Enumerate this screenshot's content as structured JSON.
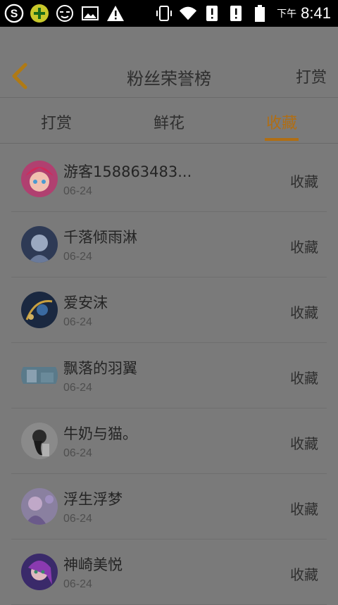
{
  "status_bar": {
    "time_prefix": "下午",
    "time": "8:41",
    "icons": [
      "sogou-icon",
      "plus-app-icon",
      "face-app-icon",
      "image-icon",
      "warning-icon"
    ],
    "right_icons": [
      "vibrate-icon",
      "wifi-icon",
      "alert-sim1-icon",
      "alert-sim2-icon",
      "battery-icon"
    ]
  },
  "header": {
    "title": "粉丝荣誉榜",
    "action": "打赏"
  },
  "tabs": [
    {
      "label": "打赏",
      "active": false
    },
    {
      "label": "鲜花",
      "active": false
    },
    {
      "label": "收藏",
      "active": true
    }
  ],
  "colors": {
    "accent": "#b06e14",
    "background": "#7a7a7a"
  },
  "list": [
    {
      "name": "游客158863483...",
      "date": "06-24",
      "action": "收藏",
      "avatar_color": "#c24a7a"
    },
    {
      "name": "千落倾雨淋",
      "date": "06-24",
      "action": "收藏",
      "avatar_color": "#4a5a7a"
    },
    {
      "name": "爱安沫",
      "date": "06-24",
      "action": "收藏",
      "avatar_color": "#2a3a5a"
    },
    {
      "name": "飘落的羽翼",
      "date": "06-24",
      "action": "收藏",
      "avatar_color": "#6a8a9a"
    },
    {
      "name": "牛奶与猫。",
      "date": "06-24",
      "action": "收藏",
      "avatar_color": "#9a9a9a"
    },
    {
      "name": "浮生浮梦",
      "date": "06-24",
      "action": "收藏",
      "avatar_color": "#8a7aa0"
    },
    {
      "name": "神崎美悦",
      "date": "06-24",
      "action": "收藏",
      "avatar_color": "#6a4a9a"
    }
  ]
}
